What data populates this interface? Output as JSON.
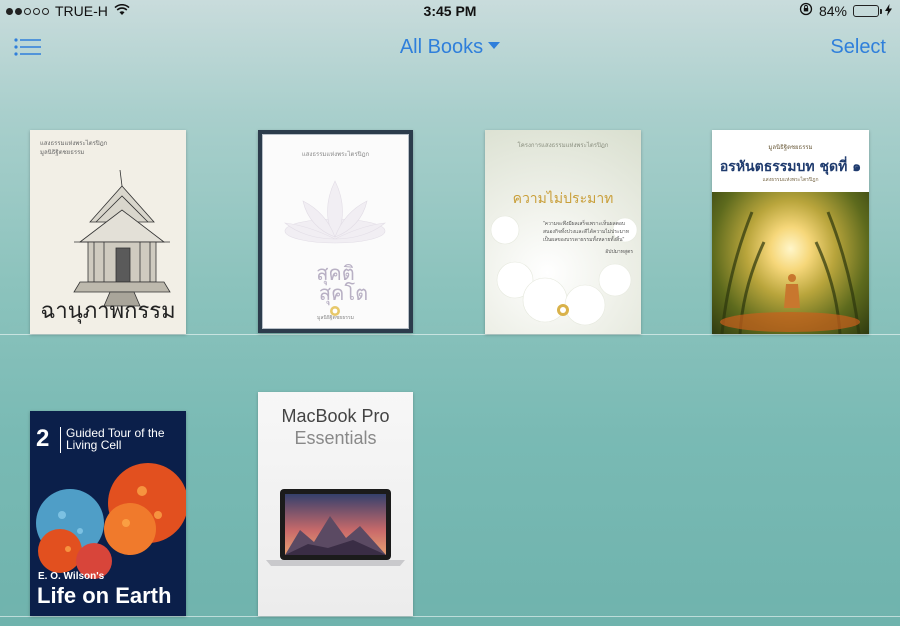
{
  "status_bar": {
    "carrier": "TRUE-H",
    "time": "3:45 PM",
    "battery_percent": "84%",
    "battery_level": 0.84,
    "icons": [
      "signal-dots-icon",
      "wifi-icon",
      "orientation-lock-icon",
      "battery-icon",
      "charging-bolt-icon"
    ]
  },
  "nav": {
    "menu_icon": "list-icon",
    "title": "All Books",
    "select_label": "Select",
    "accent": "#2f7fdb"
  },
  "books": [
    {
      "title": "ฉานุภาพกรรม",
      "header_lines": [
        "แสงธรรมแห่งพระไตรปิฎก",
        "มูลนิธิฐิตชยธรรม"
      ]
    },
    {
      "title_line1": "สุคติ",
      "title_line2": "สุคโต",
      "header": "แสงธรรมแห่งพระไตรปิฎก",
      "publisher": "มูลนิธิฐิตชยธรรม"
    },
    {
      "title": "ความไม่ประมาท",
      "header": "โครงการแสงธรรมแห่งพระไตรปิฎก",
      "quote": "\"ความจะพึงมีผลเสร็จเพราะเห็นผลตอบสนองกิจทั้งปวงและดีได้ความไม่ประมาทเป็นผลของบรรดาธรรมทั้งหลายทั้งสิ้น\"",
      "signature": "อัปปมาทสูตร"
    },
    {
      "header": "มูลนิธิฐิตชยธรรม",
      "title": "อรหันตธรรมบท ชุดที่ ๑",
      "subtitle": "แสงธรรมแห่งพระไตรปิฎก"
    },
    {
      "number": "2",
      "series_title": "Guided Tour of the Living Cell",
      "author": "E. O. Wilson's",
      "title": "Life on Earth"
    },
    {
      "title_line1": "MacBook Pro",
      "title_line2": "Essentials"
    }
  ]
}
